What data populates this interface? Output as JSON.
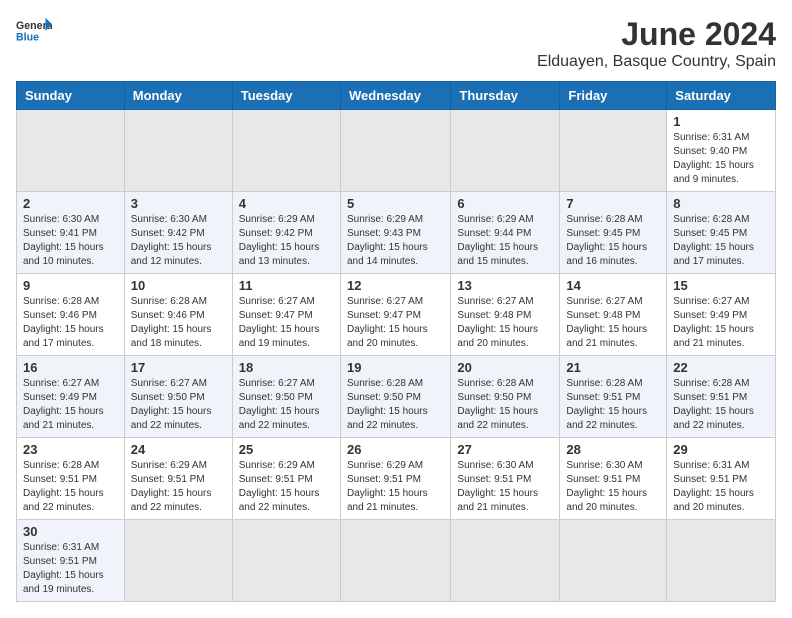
{
  "header": {
    "logo_general": "General",
    "logo_blue": "Blue",
    "month_year": "June 2024",
    "location": "Elduayen, Basque Country, Spain"
  },
  "weekdays": [
    "Sunday",
    "Monday",
    "Tuesday",
    "Wednesday",
    "Thursday",
    "Friday",
    "Saturday"
  ],
  "weeks": [
    [
      {
        "day": "",
        "info": ""
      },
      {
        "day": "",
        "info": ""
      },
      {
        "day": "",
        "info": ""
      },
      {
        "day": "",
        "info": ""
      },
      {
        "day": "",
        "info": ""
      },
      {
        "day": "",
        "info": ""
      },
      {
        "day": "1",
        "info": "Sunrise: 6:31 AM\nSunset: 9:40 PM\nDaylight: 15 hours and 9 minutes."
      }
    ],
    [
      {
        "day": "2",
        "info": "Sunrise: 6:30 AM\nSunset: 9:41 PM\nDaylight: 15 hours and 10 minutes."
      },
      {
        "day": "3",
        "info": "Sunrise: 6:30 AM\nSunset: 9:42 PM\nDaylight: 15 hours and 12 minutes."
      },
      {
        "day": "4",
        "info": "Sunrise: 6:29 AM\nSunset: 9:42 PM\nDaylight: 15 hours and 13 minutes."
      },
      {
        "day": "5",
        "info": "Sunrise: 6:29 AM\nSunset: 9:43 PM\nDaylight: 15 hours and 14 minutes."
      },
      {
        "day": "6",
        "info": "Sunrise: 6:29 AM\nSunset: 9:44 PM\nDaylight: 15 hours and 15 minutes."
      },
      {
        "day": "7",
        "info": "Sunrise: 6:28 AM\nSunset: 9:45 PM\nDaylight: 15 hours and 16 minutes."
      },
      {
        "day": "8",
        "info": "Sunrise: 6:28 AM\nSunset: 9:45 PM\nDaylight: 15 hours and 17 minutes."
      }
    ],
    [
      {
        "day": "9",
        "info": "Sunrise: 6:28 AM\nSunset: 9:46 PM\nDaylight: 15 hours and 17 minutes."
      },
      {
        "day": "10",
        "info": "Sunrise: 6:28 AM\nSunset: 9:46 PM\nDaylight: 15 hours and 18 minutes."
      },
      {
        "day": "11",
        "info": "Sunrise: 6:27 AM\nSunset: 9:47 PM\nDaylight: 15 hours and 19 minutes."
      },
      {
        "day": "12",
        "info": "Sunrise: 6:27 AM\nSunset: 9:47 PM\nDaylight: 15 hours and 20 minutes."
      },
      {
        "day": "13",
        "info": "Sunrise: 6:27 AM\nSunset: 9:48 PM\nDaylight: 15 hours and 20 minutes."
      },
      {
        "day": "14",
        "info": "Sunrise: 6:27 AM\nSunset: 9:48 PM\nDaylight: 15 hours and 21 minutes."
      },
      {
        "day": "15",
        "info": "Sunrise: 6:27 AM\nSunset: 9:49 PM\nDaylight: 15 hours and 21 minutes."
      }
    ],
    [
      {
        "day": "16",
        "info": "Sunrise: 6:27 AM\nSunset: 9:49 PM\nDaylight: 15 hours and 21 minutes."
      },
      {
        "day": "17",
        "info": "Sunrise: 6:27 AM\nSunset: 9:50 PM\nDaylight: 15 hours and 22 minutes."
      },
      {
        "day": "18",
        "info": "Sunrise: 6:27 AM\nSunset: 9:50 PM\nDaylight: 15 hours and 22 minutes."
      },
      {
        "day": "19",
        "info": "Sunrise: 6:28 AM\nSunset: 9:50 PM\nDaylight: 15 hours and 22 minutes."
      },
      {
        "day": "20",
        "info": "Sunrise: 6:28 AM\nSunset: 9:50 PM\nDaylight: 15 hours and 22 minutes."
      },
      {
        "day": "21",
        "info": "Sunrise: 6:28 AM\nSunset: 9:51 PM\nDaylight: 15 hours and 22 minutes."
      },
      {
        "day": "22",
        "info": "Sunrise: 6:28 AM\nSunset: 9:51 PM\nDaylight: 15 hours and 22 minutes."
      }
    ],
    [
      {
        "day": "23",
        "info": "Sunrise: 6:28 AM\nSunset: 9:51 PM\nDaylight: 15 hours and 22 minutes."
      },
      {
        "day": "24",
        "info": "Sunrise: 6:29 AM\nSunset: 9:51 PM\nDaylight: 15 hours and 22 minutes."
      },
      {
        "day": "25",
        "info": "Sunrise: 6:29 AM\nSunset: 9:51 PM\nDaylight: 15 hours and 22 minutes."
      },
      {
        "day": "26",
        "info": "Sunrise: 6:29 AM\nSunset: 9:51 PM\nDaylight: 15 hours and 21 minutes."
      },
      {
        "day": "27",
        "info": "Sunrise: 6:30 AM\nSunset: 9:51 PM\nDaylight: 15 hours and 21 minutes."
      },
      {
        "day": "28",
        "info": "Sunrise: 6:30 AM\nSunset: 9:51 PM\nDaylight: 15 hours and 20 minutes."
      },
      {
        "day": "29",
        "info": "Sunrise: 6:31 AM\nSunset: 9:51 PM\nDaylight: 15 hours and 20 minutes."
      }
    ],
    [
      {
        "day": "30",
        "info": "Sunrise: 6:31 AM\nSunset: 9:51 PM\nDaylight: 15 hours and 19 minutes."
      },
      {
        "day": "",
        "info": ""
      },
      {
        "day": "",
        "info": ""
      },
      {
        "day": "",
        "info": ""
      },
      {
        "day": "",
        "info": ""
      },
      {
        "day": "",
        "info": ""
      },
      {
        "day": "",
        "info": ""
      }
    ]
  ]
}
